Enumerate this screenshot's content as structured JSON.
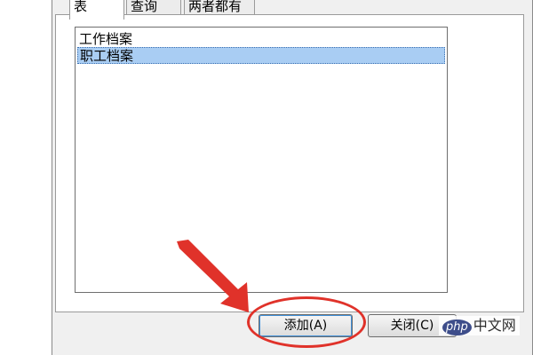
{
  "tabs": [
    {
      "label": "表",
      "active": true
    },
    {
      "label": "查询",
      "active": false
    },
    {
      "label": "两者都有",
      "active": false
    }
  ],
  "list": {
    "items": [
      {
        "label": "工作档案",
        "selected": false
      },
      {
        "label": "职工档案",
        "selected": true
      }
    ]
  },
  "buttons": {
    "add_label": "添加(A)",
    "close_label": "关闭(C)"
  },
  "annotation": {
    "color": "#e0322a"
  },
  "watermark": {
    "logo_text": "php",
    "site_text": "中文网"
  }
}
